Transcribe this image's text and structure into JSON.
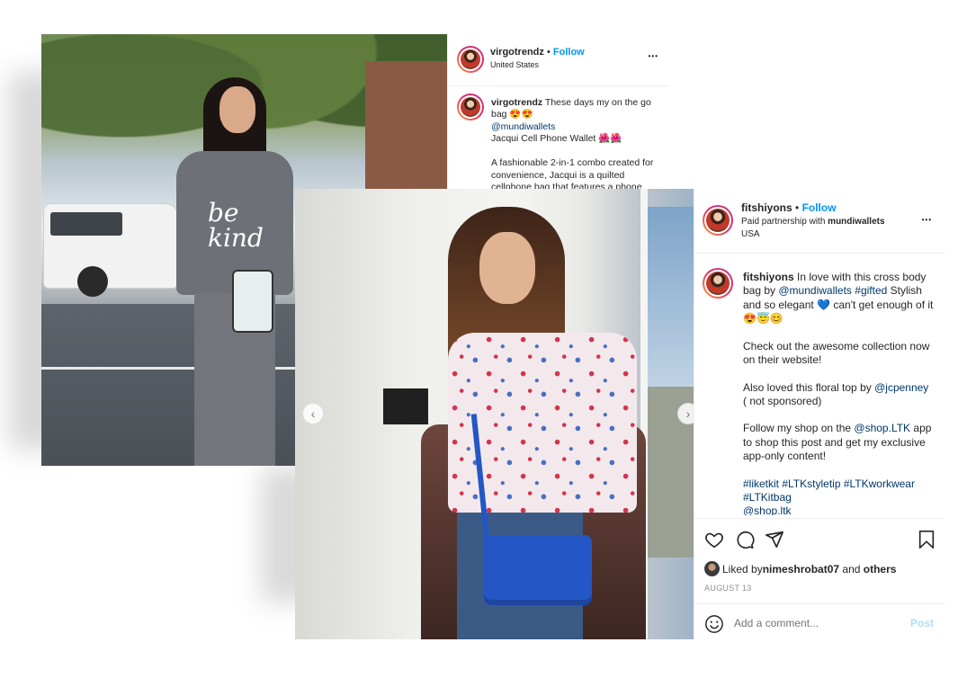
{
  "post1": {
    "username": "virgotrendz",
    "separator": "•",
    "follow_label": "Follow",
    "location": "United States",
    "more_label": "•••",
    "caption": {
      "username": "virgotrendz",
      "line1": "These days my on the go bag 😍😍",
      "mention": "@mundiwallets",
      "line2": "Jacqui Cell Phone Wallet 🌺🌺",
      "line3": "A fashionable 2-in-1 combo created for convenience, Jacqui is a quilted cellphone bag that features a phone"
    },
    "shirt_text": "be kind"
  },
  "post2": {
    "username": "fitshiyons",
    "separator": "•",
    "follow_label": "Follow",
    "partnership_prefix": "Paid partnership with ",
    "partner": "mundiwallets",
    "location": "USA",
    "more_label": "•••",
    "caption": {
      "username": "fitshiyons",
      "text1": "In love with this cross body bag by",
      "mention1": "@mundiwallets",
      "hashtag1": "#gifted",
      "text2": "Stylish and so elegant 💙 can't get enough of it 😍😇😊",
      "para2": "Check out the awesome collection now on their website!",
      "para3_text": "Also loved this floral top by",
      "para3_mention": "@jcpenney",
      "para3_tail": "( not sponsored)",
      "para4_text1": "Follow my shop on the",
      "para4_mention": "@shop.LTK",
      "para4_text2": "app to shop this post and get my exclusive app-only content!",
      "hashtags": "#liketkit #LTKstyletip #LTKworkwear #LTKitbag",
      "tail_mention": "@shop.ltk"
    },
    "likes_prefix": "Liked by ",
    "liked_by_user": "nimeshrobat07",
    "likes_and": " and ",
    "likes_others": "others",
    "date": "AUGUST 13",
    "comment_placeholder": "Add a comment...",
    "post_label": "Post"
  },
  "icons": {
    "heart": "heart-icon",
    "comment": "comment-icon",
    "share": "share-icon",
    "bookmark": "bookmark-icon",
    "emoji": "emoji-icon",
    "prev": "chevron-left-icon",
    "next": "chevron-right-icon"
  },
  "colors": {
    "follow_blue": "#0095f6",
    "link_navy": "#00376b",
    "post_disabled": "#b2dffc"
  }
}
